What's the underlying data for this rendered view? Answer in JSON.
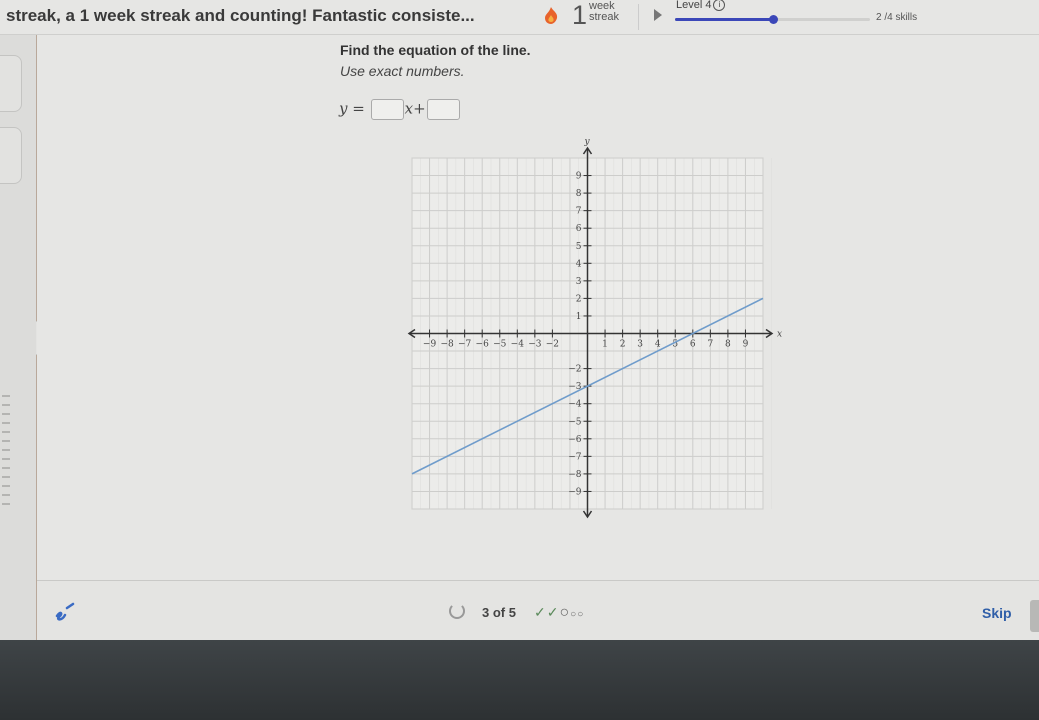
{
  "topbar": {
    "streak_message": "streak, a 1 week streak and counting! Fantastic consiste...",
    "streak_icon": "flame-icon",
    "streak_count": "1",
    "streak_unit_line1": "week",
    "streak_unit_line2": "streak",
    "level_label": "Level 4",
    "level_info_icon": "ⓘ",
    "level_progress_fraction": 0.5,
    "skills_text": "2 /4 skills",
    "accent_color": "#3b47b8"
  },
  "question": {
    "title": "Find the equation of the line.",
    "subtitle": "Use exact numbers.",
    "equation": {
      "lhs": "y",
      "equals": "=",
      "x_term": "x",
      "plus": "+",
      "slope_input_value": "",
      "intercept_input_value": ""
    }
  },
  "sidebar": {
    "collapse_glyph": "<"
  },
  "bottom": {
    "counter_text": "3 of 5",
    "progress_marks": [
      "✓",
      "✓",
      "○",
      "○",
      "○"
    ],
    "skip_label": "Skip"
  },
  "chart_data": {
    "type": "line",
    "title": "",
    "xlabel": "x",
    "ylabel": "y",
    "xlim": [
      -10,
      10
    ],
    "ylim": [
      -10,
      10
    ],
    "grid": true,
    "x_ticks": [
      -9,
      -8,
      -7,
      -6,
      -5,
      -4,
      -3,
      -2,
      1,
      2,
      3,
      4,
      5,
      6,
      7,
      8,
      9
    ],
    "y_ticks": [
      9,
      8,
      7,
      6,
      5,
      4,
      3,
      2,
      1,
      -2,
      -3,
      -4,
      -5,
      -6,
      -7,
      -8,
      -9
    ],
    "series": [
      {
        "name": "line",
        "color": "#6f9ccb",
        "points": [
          [
            -10,
            -8
          ],
          [
            10,
            2
          ]
        ]
      }
    ],
    "notable_points": [
      [
        0,
        -3
      ],
      [
        6,
        0
      ]
    ]
  }
}
